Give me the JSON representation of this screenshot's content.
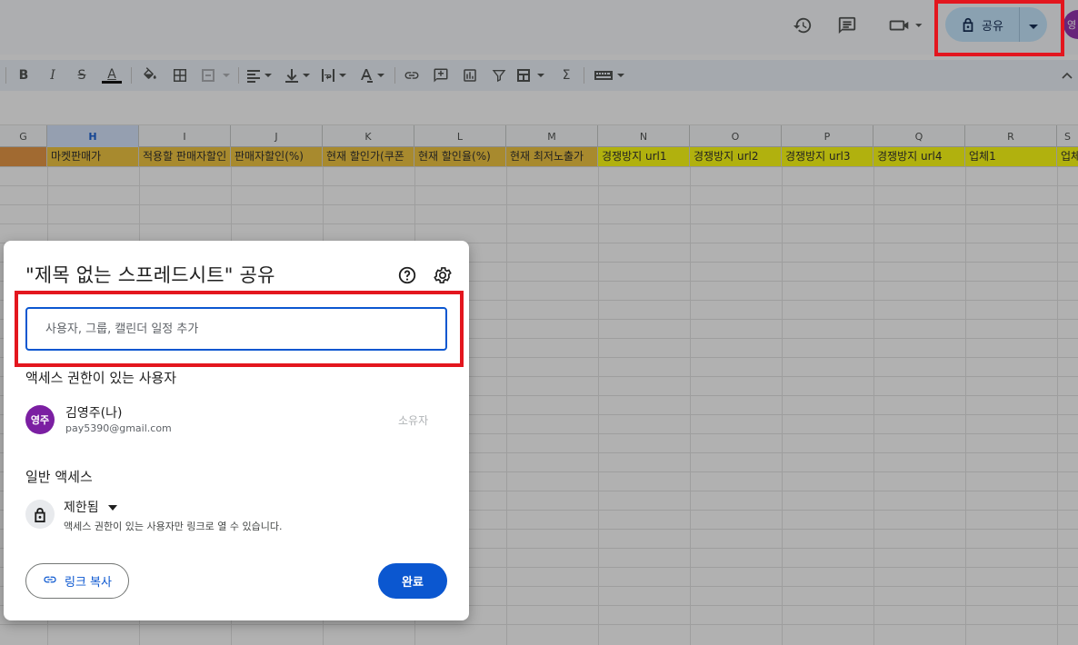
{
  "topbar": {
    "share_label": "공유",
    "avatar_initial": "영",
    "icons": [
      "history-icon",
      "comment-icon",
      "video-call-icon",
      "lock-icon",
      "chevron-down-icon"
    ]
  },
  "toolbar": {
    "bold": "B",
    "italic": "I",
    "strikethrough": "S",
    "text_color": "A",
    "font_color_swatch": "#000000",
    "functions": "Σ"
  },
  "sheet": {
    "columns": [
      "G",
      "H",
      "I",
      "J",
      "K",
      "L",
      "M",
      "N",
      "O",
      "P",
      "Q",
      "R",
      "S"
    ],
    "selected_column": "H",
    "header_row": [
      "",
      "마켓판매가",
      "적용할 판매자할인",
      "판매자할인(%)",
      "현재 할인가(쿠폰",
      "현재 할인율(%)",
      "현재 최저노출가",
      "경쟁방지 url1",
      "경쟁방지 url2",
      "경쟁방지 url3",
      "경쟁방지 url4",
      "업체1",
      "업체"
    ],
    "header_colors": {
      "orange": "#f1c232",
      "yellow": "#ffff00",
      "g_col": "#e69138"
    }
  },
  "dialog": {
    "title": "\"제목 없는 스프레드시트\" 공유",
    "add_placeholder": "사용자, 그룹, 캘린더 일정 추가",
    "people_heading": "액세스 권한이 있는 사용자",
    "user": {
      "initials": "영주",
      "name": "김영주(나)",
      "email": "pay5390@gmail.com",
      "role": "소유자"
    },
    "general_heading": "일반 액세스",
    "access": {
      "level": "제한됨",
      "description": "액세스 권한이 있는 사용자만 링크로 열 수 있습니다."
    },
    "copy_link_label": "링크 복사",
    "done_label": "완료"
  },
  "colors": {
    "accent": "#0b57d0",
    "highlight": "#e3161e",
    "share_pill": "#c2e7ff"
  }
}
